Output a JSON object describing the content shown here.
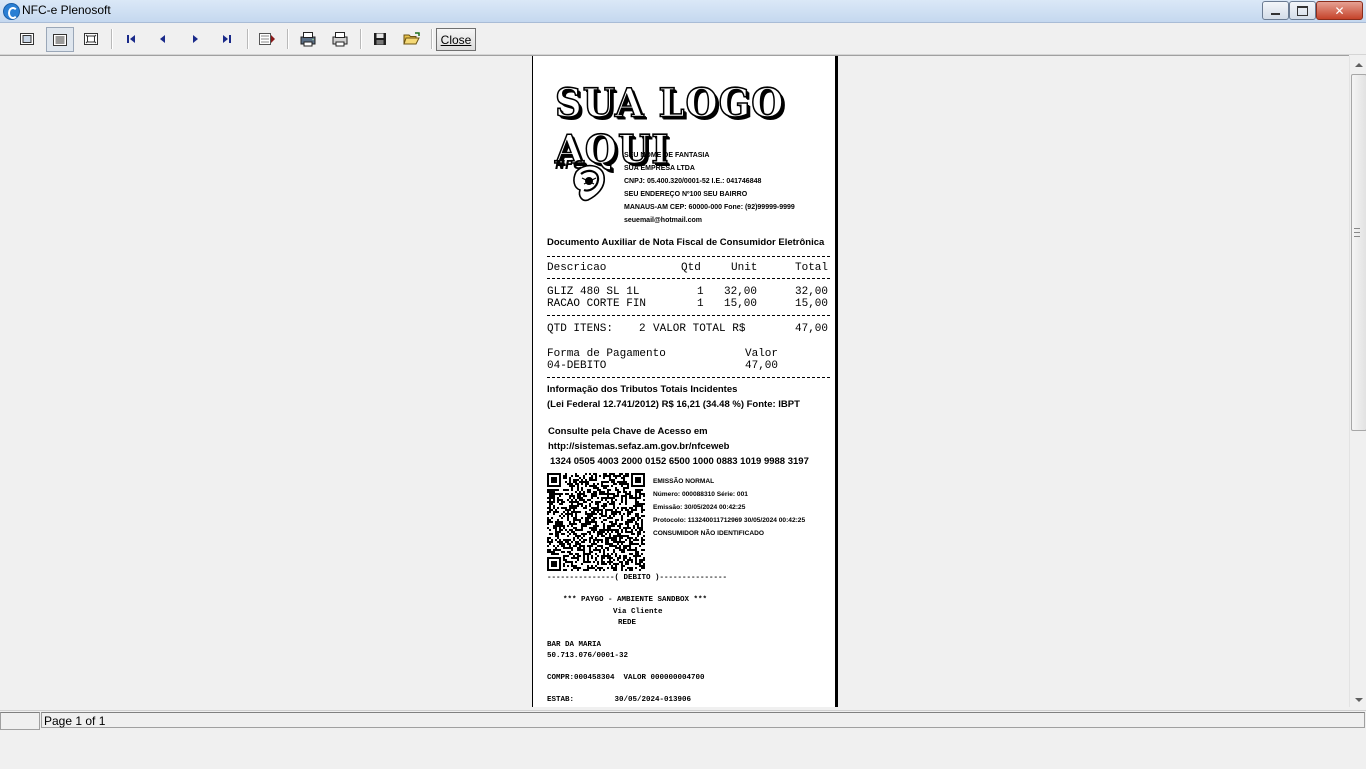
{
  "window": {
    "title": "NFC-e Plenosoft"
  },
  "toolbar": {
    "icons": [
      "one-page-icon",
      "page-width-icon",
      "fit-page-icon",
      "first-page-icon",
      "previous-page-icon",
      "next-page-icon",
      "last-page-icon",
      "goto-page-icon",
      "printer-setup-icon",
      "print-icon",
      "save-icon",
      "open-icon"
    ],
    "close_label": "Close"
  },
  "receipt": {
    "logo_text": "SUA LOGO AQUI",
    "nfce_logo_text": "NFC",
    "company": {
      "fantasy_name": "SEU NOME DE FANTASIA",
      "company_name": "SUA EMPRESA LTDA",
      "cnpj_ie": "CNPJ: 05.400.320/0001-52 I.E.: 041746848",
      "address": "SEU ENDEREÇO Nº100 SEU BAIRRO",
      "city_cep_phone": "MANAUS-AM CEP: 60000-000 Fone: (92)99999-9999",
      "email": "seuemail@hotmail.com"
    },
    "doc_title": "Documento Auxiliar de Nota Fiscal de Consumidor Eletrônica",
    "columns": {
      "descricao": "Descricao",
      "qtd": "Qtd",
      "unit": "Unit",
      "total": "Total"
    },
    "items": [
      {
        "descricao": "GLIZ 480 SL 1L",
        "qtd": "1",
        "unit": "32,00",
        "total": "32,00"
      },
      {
        "descricao": "RACAO CORTE FIN",
        "qtd": "1",
        "unit": "15,00",
        "total": "15,00"
      }
    ],
    "totals": {
      "qtd_label": "QTD ITENS:",
      "qtd_value": "2",
      "total_label": "VALOR TOTAL R$",
      "total_value": "47,00"
    },
    "payment": {
      "header_label": "Forma de Pagamento",
      "header_value": "Valor",
      "method": "04-DEBITO",
      "value": "47,00"
    },
    "tributos": {
      "title": "Informação dos Tributos Totais Incidentes",
      "detail": "(Lei Federal 12.741/2012) R$ 16,21 (34.48 %) Fonte: IBPT"
    },
    "consulta": {
      "title": "Consulte pela Chave de Acesso em",
      "url": "http://sistemas.sefaz.am.gov.br/nfceweb",
      "key": "1324 0505 4003 2000 0152 6500 1000 0883 1019 9988 3197"
    },
    "emission": {
      "type": "EMISSÃO NORMAL",
      "number": "Número: 000088310 Série: 001",
      "date": "Emissão: 30/05/2024 00:42:25",
      "protocol": "Protocolo: 113240011712969 30/05/2024 00:42:25",
      "consumer": "CONSUMIDOR NÃO IDENTIFICADO"
    },
    "tef": {
      "separator": "---------------( DEBITO )---------------",
      "line1": "*** PAYGO - AMBIENTE SANDBOX ***",
      "line2": "Via Cliente",
      "line3": "REDE",
      "merchant": "BAR DA MARIA",
      "merchant_cnpj": "50.713.076/0001-32",
      "compr": "COMPR:000458304  VALOR 000000004700",
      "estab": "ESTAB:         30/05/2024-013906"
    }
  },
  "status": {
    "page_text": "Page 1 of 1"
  }
}
